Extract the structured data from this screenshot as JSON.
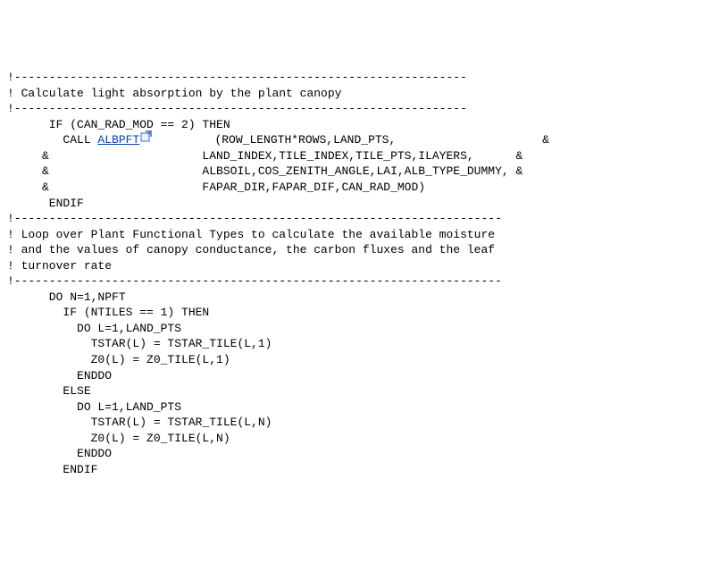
{
  "lines": {
    "l01": "!-----------------------------------------------------------------",
    "l02": "! Calculate light absorption by the plant canopy",
    "l03": "!-----------------------------------------------------------------",
    "l04": "      IF (CAN_RAD_MOD == 2) THEN",
    "l05a": "        CALL ",
    "link_text": "ALBPFT",
    "l05b": "         (ROW_LENGTH*ROWS,LAND_PTS,                     &",
    "l06": "     &                      LAND_INDEX,TILE_INDEX,TILE_PTS,ILAYERS,      &",
    "l07": "     &                      ALBSOIL,COS_ZENITH_ANGLE,LAI,ALB_TYPE_DUMMY, &",
    "l08": "     &                      FAPAR_DIR,FAPAR_DIF,CAN_RAD_MOD)",
    "l09": "",
    "l10": "      ENDIF",
    "l11": "",
    "l12": "",
    "l13": "!----------------------------------------------------------------------",
    "l14": "! Loop over Plant Functional Types to calculate the available moisture",
    "l15": "! and the values of canopy conductance, the carbon fluxes and the leaf",
    "l16": "! turnover rate",
    "l17": "!----------------------------------------------------------------------",
    "l18": "      DO N=1,NPFT",
    "l19": "",
    "l20": "        IF (NTILES == 1) THEN",
    "l21": "          DO L=1,LAND_PTS",
    "l22": "            TSTAR(L) = TSTAR_TILE(L,1)",
    "l23": "            Z0(L) = Z0_TILE(L,1)",
    "l24": "          ENDDO",
    "l25": "        ELSE",
    "l26": "          DO L=1,LAND_PTS",
    "l27": "            TSTAR(L) = TSTAR_TILE(L,N)",
    "l28": "            Z0(L) = Z0_TILE(L,N)",
    "l29": "          ENDDO",
    "l30": "        ENDIF"
  }
}
